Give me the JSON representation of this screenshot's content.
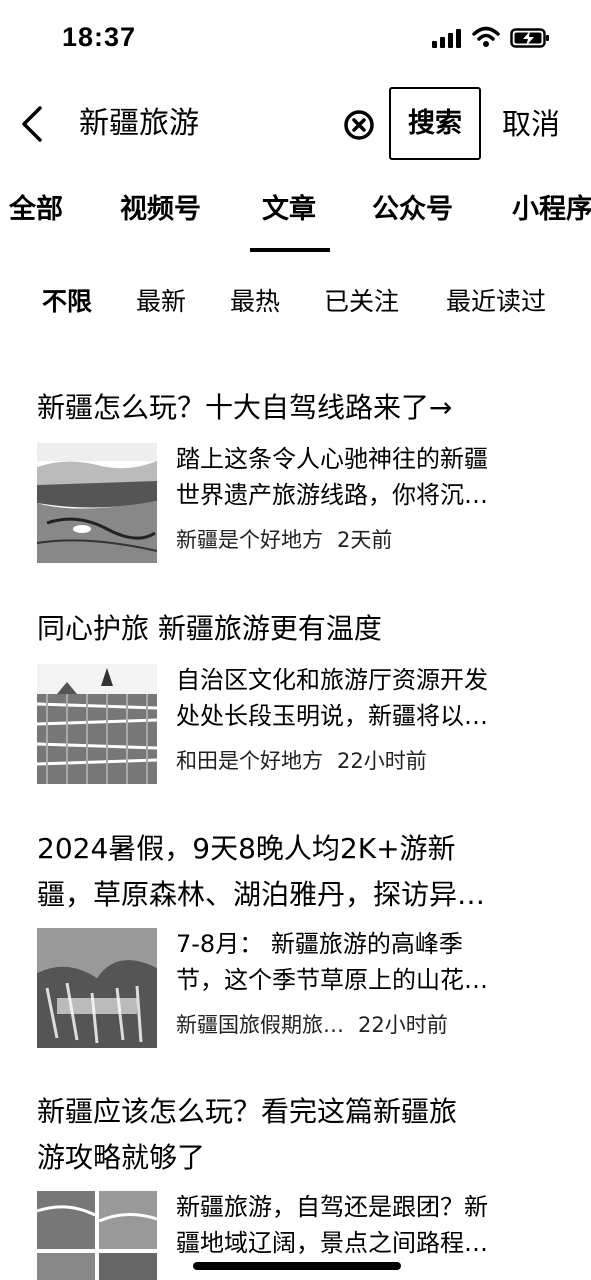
{
  "status_bar": {
    "time": "18:37"
  },
  "search": {
    "query": "新疆旅游",
    "search_label": "搜索",
    "cancel_label": "取消"
  },
  "tabs": [
    {
      "label": "全部"
    },
    {
      "label": "视频号"
    },
    {
      "label": "文章",
      "active": true
    },
    {
      "label": "公众号"
    },
    {
      "label": "小程序"
    }
  ],
  "filters": [
    {
      "label": "不限",
      "active": true
    },
    {
      "label": "最新"
    },
    {
      "label": "最热"
    },
    {
      "label": "已关注"
    },
    {
      "label": "最近读过"
    }
  ],
  "results": [
    {
      "title_lines": [
        "新疆怎么玩？十大自驾线路来了→"
      ],
      "snippet_lines": [
        "踏上这条令人心驰神往的新疆",
        "世界遗产旅游线路，你将沉…"
      ],
      "source": "新疆是个好地方",
      "time": "2天前"
    },
    {
      "title_lines": [
        "同心护旅 新疆旅游更有温度"
      ],
      "snippet_lines": [
        "自治区文化和旅游厅资源开发",
        "处处长段玉明说，新疆将以…"
      ],
      "source": "和田是个好地方",
      "time": "22小时前"
    },
    {
      "title_lines": [
        "2024暑假，9天8晚人均2K+游新",
        "疆，草原森林、湖泊雅丹，探访异…"
      ],
      "snippet_lines": [
        "7-8月： 新疆旅游的高峰季",
        "节，这个季节草原上的山花…"
      ],
      "source": "新疆国旅假期旅…",
      "time": "22小时前"
    },
    {
      "title_lines": [
        "新疆应该怎么玩？看完这篇新疆旅",
        "游攻略就够了"
      ],
      "snippet_lines": [
        "新疆旅游，自驾还是跟团？新",
        "疆地域辽阔，景点之间路程…"
      ],
      "source": "",
      "time": ""
    }
  ],
  "colors": {
    "text": "#000000",
    "background": "#ffffff"
  }
}
